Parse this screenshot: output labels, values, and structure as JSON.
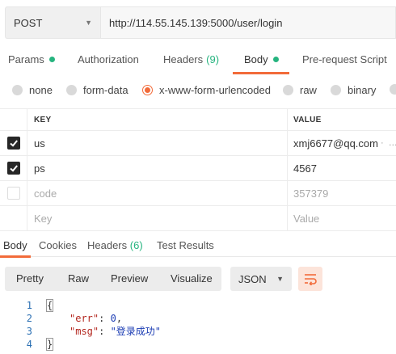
{
  "request": {
    "method": "POST",
    "url": "http://114.55.145.139:5000/user/login"
  },
  "request_tabs": [
    {
      "label": "Params",
      "dot": true
    },
    {
      "label": "Authorization"
    },
    {
      "label": "Headers",
      "count": "(9)"
    },
    {
      "label": "Body",
      "dot": true,
      "active": true
    },
    {
      "label": "Pre-request Script"
    }
  ],
  "body_types": [
    {
      "label": "none"
    },
    {
      "label": "form-data"
    },
    {
      "label": "x-www-form-urlencoded",
      "selected": true
    },
    {
      "label": "raw"
    },
    {
      "label": "binary"
    }
  ],
  "table": {
    "key_header": "KEY",
    "value_header": "VALUE",
    "rows": [
      {
        "key": "us",
        "value": "xmj6677@qq.com",
        "checked": true
      },
      {
        "key": "ps",
        "value": "4567",
        "checked": true
      },
      {
        "key": "code",
        "value": "357379",
        "checked": false
      }
    ],
    "placeholder_key": "Key",
    "placeholder_value": "Value"
  },
  "response_tabs": [
    {
      "label": "Body",
      "active": true
    },
    {
      "label": "Cookies"
    },
    {
      "label": "Headers",
      "count": "(6)"
    },
    {
      "label": "Test Results"
    }
  ],
  "response_toolbar": {
    "views": [
      "Pretty",
      "Raw",
      "Preview",
      "Visualize"
    ],
    "format": "JSON"
  },
  "response_body": {
    "line_numbers": [
      "1",
      "2",
      "3",
      "4"
    ],
    "open_brace": "{",
    "close_brace": "}",
    "err_key": "\"err\"",
    "err_value": "0",
    "msg_key": "\"msg\"",
    "msg_value": "\"登录成功\""
  },
  "colors": {
    "accent": "#f26b3a",
    "success": "#26b47f"
  }
}
